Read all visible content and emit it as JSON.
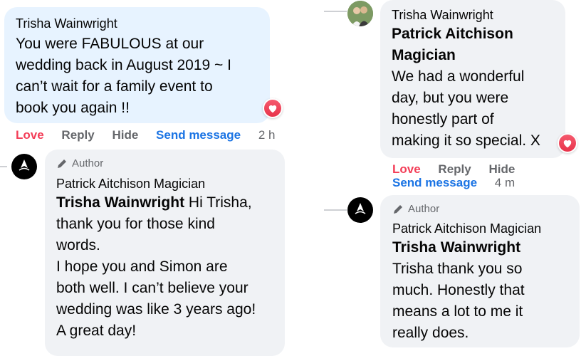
{
  "left": {
    "comment": {
      "author": "Trisha Wainwright",
      "text": "You were FABULOUS at our\nwedding back in August 2019 ~ I\ncan’t wait for a family event to\nbook you again !!",
      "reaction_icon": "heart-icon"
    },
    "actions": {
      "love": "Love",
      "reply": "Reply",
      "hide": "Hide",
      "send": "Send message",
      "time": "2 h"
    },
    "reply": {
      "badge": "Author",
      "author": "Patrick Aitchison Magician",
      "tag": "Trisha Wainwright",
      "text_first": " Hi Trisha,",
      "text_rest": "thank you for those kind\nwords.\nI hope you and Simon are\nboth well. I can’t believe your\nwedding was like 3 years ago!\nA great day!"
    }
  },
  "right": {
    "comment": {
      "author": "Trisha Wainwright",
      "tag": "Patrick Aitchison\nMagician",
      "text": "We had a wonderful\nday, but you were\nhonestly part of\nmaking it so special. X",
      "reaction_icon": "heart-icon"
    },
    "actions": {
      "love": "Love",
      "reply": "Reply",
      "hide": "Hide",
      "send": "Send message",
      "time": "4 m"
    },
    "reply": {
      "badge": "Author",
      "author": "Patrick Aitchison Magician",
      "tag": "Trisha Wainwright",
      "text": "Trisha thank you so\nmuch. Honestly that\nmeans a lot to me it\nreally does."
    }
  },
  "colors": {
    "love": "#f33e58",
    "send": "#1b74e4",
    "bubble_blue": "#e7f3ff",
    "bubble_grey": "#f0f2f5"
  }
}
